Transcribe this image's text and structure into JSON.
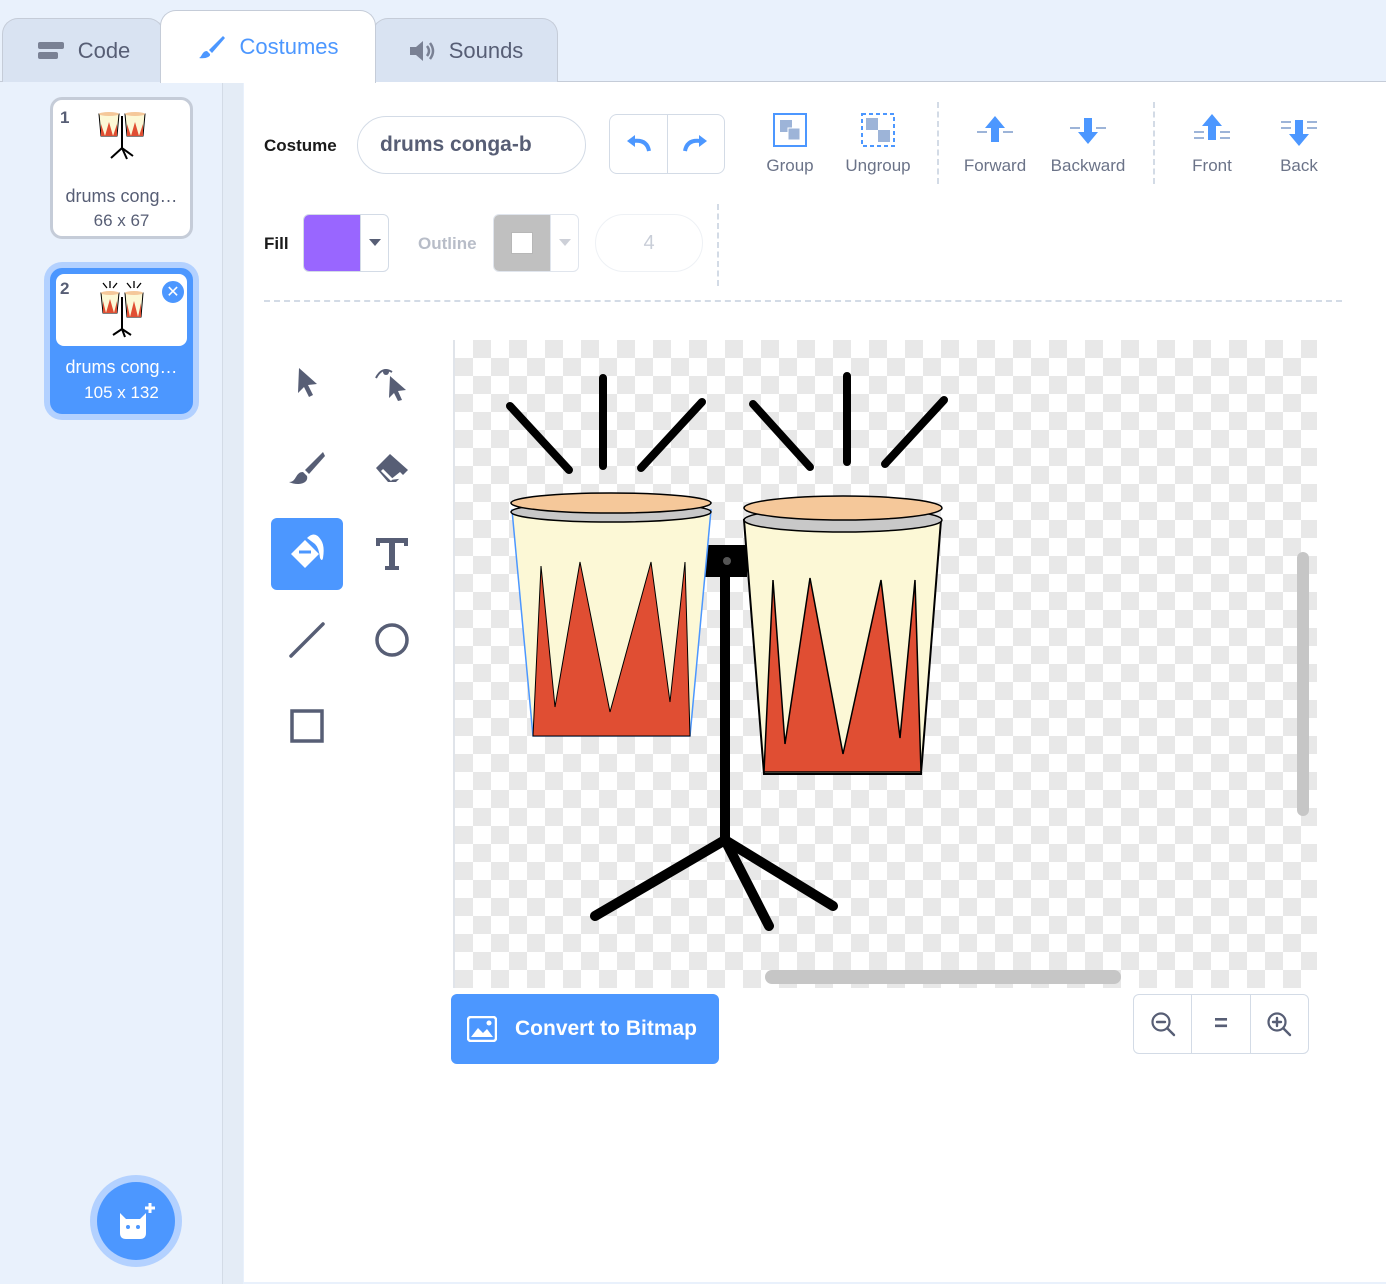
{
  "tabs": [
    {
      "label": "Code",
      "icon": "code-icon"
    },
    {
      "label": "Costumes",
      "icon": "paintbrush-icon"
    },
    {
      "label": "Sounds",
      "icon": "speaker-icon"
    }
  ],
  "active_tab": "Costumes",
  "costumes": [
    {
      "number": "1",
      "name": "drums cong…",
      "size": "66 x 67",
      "selected": false
    },
    {
      "number": "2",
      "name": "drums cong…",
      "size": "105 x 132",
      "selected": true
    }
  ],
  "editor": {
    "costume_label": "Costume",
    "costume_name": "drums conga-b",
    "toolbar": {
      "group": "Group",
      "ungroup": "Ungroup",
      "forward": "Forward",
      "backward": "Backward",
      "front": "Front",
      "back": "Back"
    },
    "fill_label": "Fill",
    "fill_color": "#9966ff",
    "outline_label": "Outline",
    "outline_color": "#a6a6a6",
    "outline_width": "4",
    "convert_button": "Convert to Bitmap",
    "zoom": {
      "out": "zoom-out-icon",
      "reset": "=",
      "in": "zoom-in-icon"
    }
  },
  "tools": [
    "select",
    "reshape",
    "brush",
    "eraser",
    "fill",
    "text",
    "line",
    "circle",
    "rectangle"
  ],
  "active_tool": "fill",
  "colors": {
    "accent": "#4c97ff",
    "drum_red": "#e04e33",
    "drum_cream": "#fcf8d6"
  }
}
